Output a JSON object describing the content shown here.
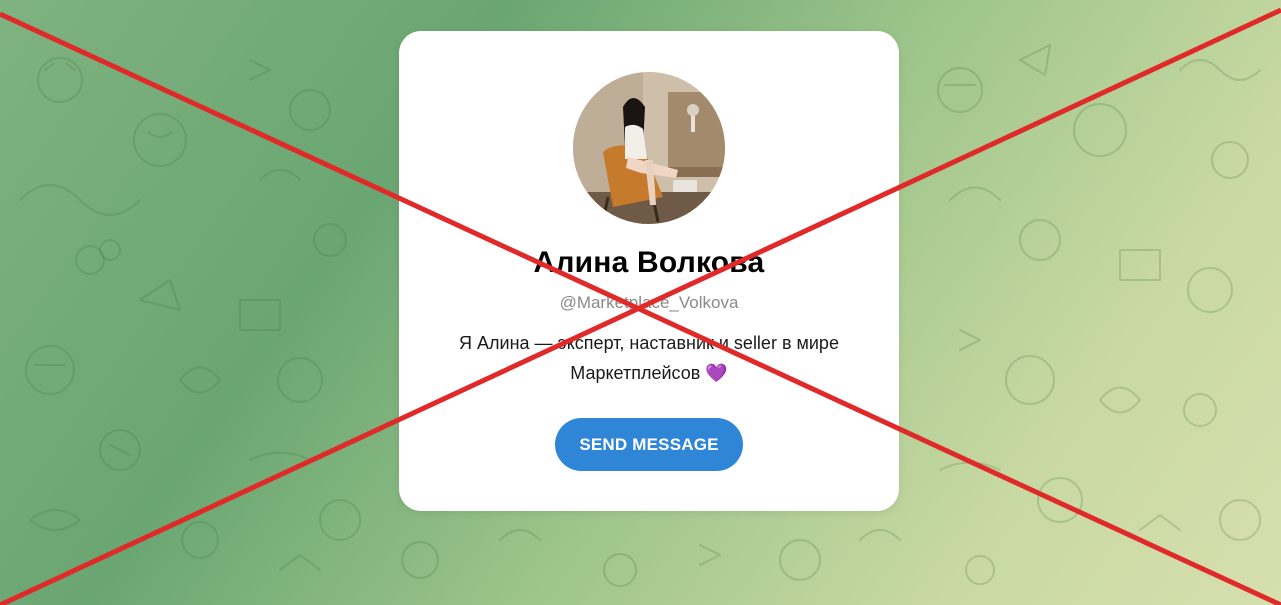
{
  "profile": {
    "name": "Алина Волкова",
    "username": "@Marketplace_Volkova",
    "bio_line1": "Я Алина — эксперт, наставник и seller в мире",
    "bio_line2": "Маркетплейсов",
    "bio_emoji": "💜",
    "avatar_icon": "profile-photo"
  },
  "actions": {
    "send_message_label": "SEND MESSAGE"
  },
  "colors": {
    "button": "#2f85d6",
    "cross_mark": "#e02a2a",
    "card": "#ffffff"
  }
}
